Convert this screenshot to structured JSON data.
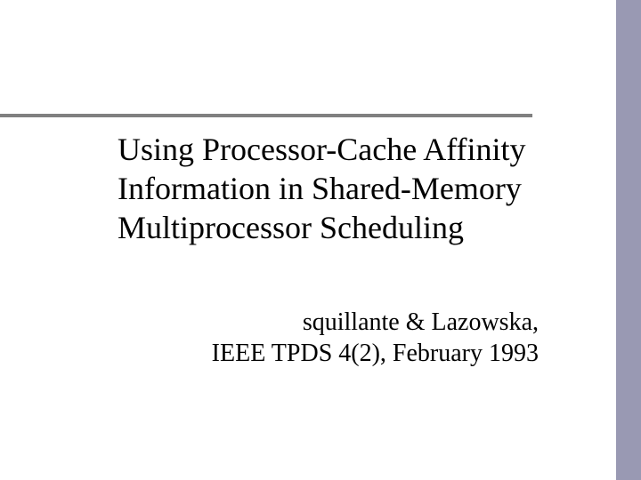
{
  "slide": {
    "title": "Using Processor-Cache Affinity Information in Shared-Memory Multiprocessor Scheduling",
    "authors_line1": "squillante & Lazowska,",
    "authors_line2": "IEEE TPDS 4(2), February 1993"
  },
  "colors": {
    "stripe": "#9999b3",
    "rule": "#808080"
  }
}
